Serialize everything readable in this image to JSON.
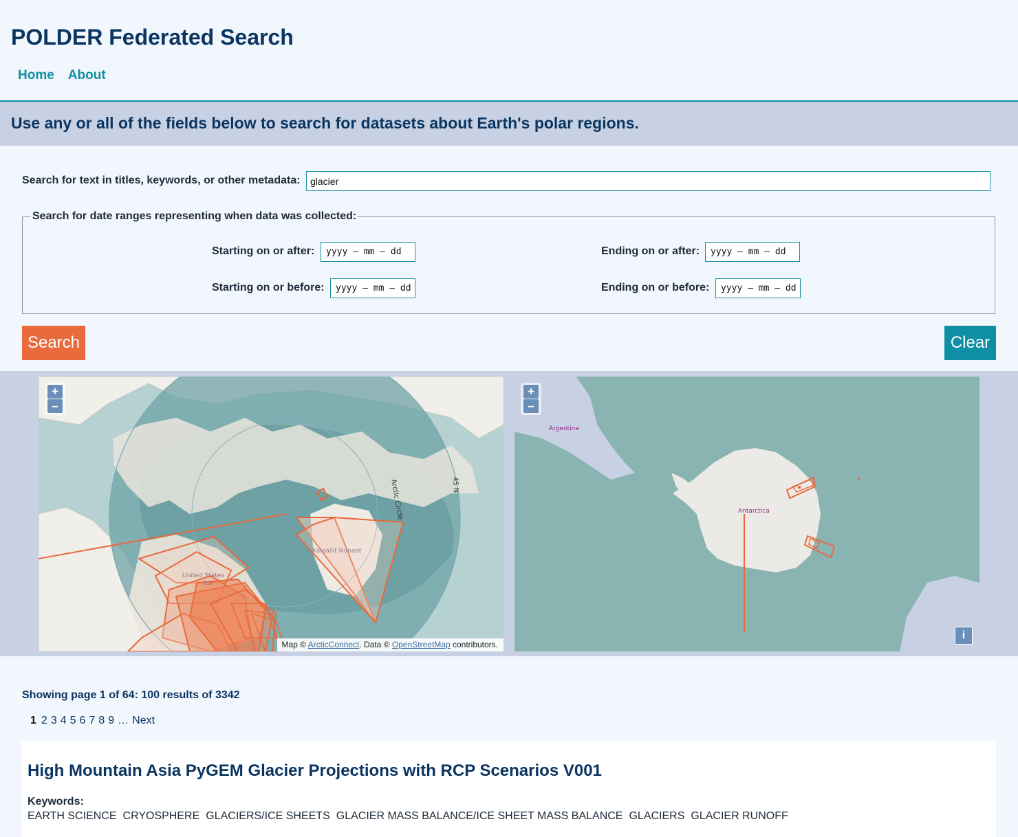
{
  "site": {
    "title": "POLDER Federated Search"
  },
  "nav": [
    {
      "label": "Home"
    },
    {
      "label": "About"
    }
  ],
  "banner": {
    "text": "Use any or all of the fields below to search for datasets about Earth's polar regions."
  },
  "search": {
    "text_label": "Search for text in titles, keywords, or other metadata:",
    "text_value": "glacier",
    "date_legend": "Search for date ranges representing when data was collected:",
    "start_after_label": "Starting on or after:",
    "start_before_label": "Starting on or before:",
    "end_after_label": "Ending on or after:",
    "end_before_label": "Ending on or before:",
    "date_placeholder": "yyyy – mm – dd",
    "search_button": "Search",
    "clear_button": "Clear"
  },
  "maps": {
    "zoom_in": "+",
    "zoom_out": "–",
    "north": {
      "labels": {
        "arctic_circle": "Arctic Circle",
        "lat_45n": "45 N",
        "greenland": "Kalaallit Nunaat",
        "us_line1": "United States",
        "us_line2": "ica"
      },
      "attribution": {
        "prefix": "Map ©",
        "arctic_connect": "ArcticConnect",
        "middle": ". Data ©",
        "osm": "OpenStreetMap",
        "suffix": "contributors."
      }
    },
    "south": {
      "labels": {
        "argentina": "Argentina",
        "antarctica": "Antarctica"
      },
      "info": "i"
    },
    "colors": {
      "footprint": "#e8693d",
      "ocean_north": "#b5d1d1",
      "ocean_south": "#8ab4b2",
      "land": "#f1efe9"
    }
  },
  "results": {
    "summary": "Showing page 1 of 64: 100 results of 3342",
    "pages": [
      "1",
      "2",
      "3",
      "4",
      "5",
      "6",
      "7",
      "8",
      "9"
    ],
    "current_page": "1",
    "ellipsis": "…",
    "next": "Next",
    "items": [
      {
        "title": "High Mountain Asia PyGEM Glacier Projections with RCP Scenarios V001",
        "keywords_label": "Keywords:",
        "keywords": [
          "EARTH SCIENCE",
          "CRYOSPHERE",
          "GLACIERS/ICE SHEETS",
          "GLACIER MASS BALANCE/ICE SHEET MASS BALANCE",
          "GLACIERS",
          "GLACIER RUNOFF"
        ]
      }
    ]
  }
}
